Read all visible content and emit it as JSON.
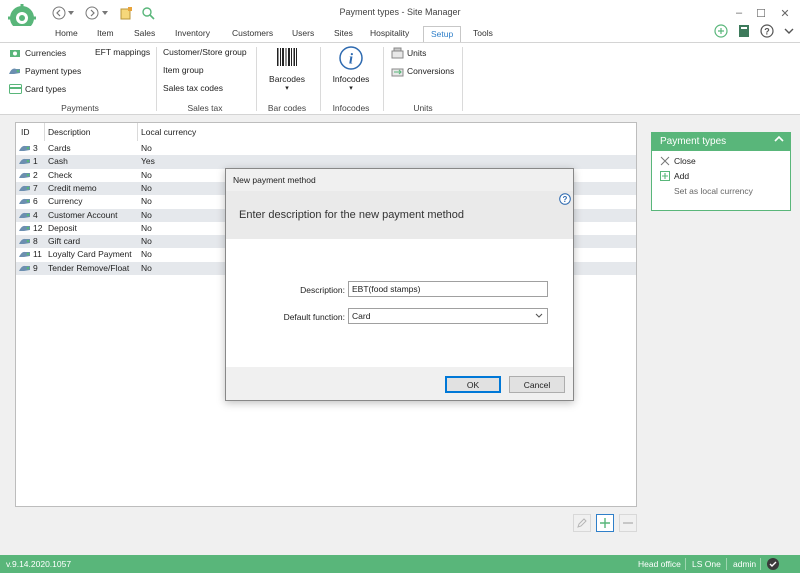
{
  "window": {
    "title": "Payment types - Site Manager",
    "minimize_glyph": "–",
    "maximize_glyph": "☐",
    "close_glyph": "✕"
  },
  "tabs": [
    {
      "label": "Home"
    },
    {
      "label": "Item"
    },
    {
      "label": "Sales"
    },
    {
      "label": "Inventory"
    },
    {
      "label": "Customers"
    },
    {
      "label": "Users"
    },
    {
      "label": "Sites"
    },
    {
      "label": "Hospitality"
    },
    {
      "label": "Setup",
      "active": true
    },
    {
      "label": "Tools"
    }
  ],
  "ribbon": {
    "payments": {
      "currencies": "Currencies",
      "payment_types": "Payment types",
      "card_types": "Card types",
      "eft_mappings": "EFT mappings",
      "group_label": "Payments"
    },
    "sales_tax": {
      "customer_store_group": "Customer/Store group",
      "item_group": "Item group",
      "sales_tax_codes": "Sales tax codes",
      "group_label": "Sales tax"
    },
    "bar_codes": {
      "barcodes": "Barcodes",
      "dropdown": "▾",
      "group_label": "Bar codes"
    },
    "infocodes": {
      "infocodes": "Infocodes",
      "dropdown": "▾",
      "group_label": "Infocodes"
    },
    "units": {
      "units": "Units",
      "conversions": "Conversions",
      "group_label": "Units"
    }
  },
  "grid": {
    "columns": [
      "ID",
      "Description",
      "Local currency"
    ],
    "rows": [
      {
        "id": "3",
        "description": "Cards",
        "local": "No"
      },
      {
        "id": "1",
        "description": "Cash",
        "local": "Yes"
      },
      {
        "id": "2",
        "description": "Check",
        "local": "No"
      },
      {
        "id": "7",
        "description": "Credit memo",
        "local": "No"
      },
      {
        "id": "6",
        "description": "Currency",
        "local": "No"
      },
      {
        "id": "4",
        "description": "Customer Account",
        "local": "No"
      },
      {
        "id": "12",
        "description": "Deposit",
        "local": "No"
      },
      {
        "id": "8",
        "description": "Gift card",
        "local": "No"
      },
      {
        "id": "11",
        "description": "Loyalty Card Payment",
        "local": "No"
      },
      {
        "id": "9",
        "description": "Tender Remove/Float",
        "local": "No"
      }
    ]
  },
  "side_panel": {
    "title": "Payment types",
    "collapse_glyph": "⌃",
    "close": "Close",
    "add": "Add",
    "set_local": "Set as local currency"
  },
  "dialog": {
    "title": "New payment method",
    "heading": "Enter description for the new payment method",
    "description_label": "Description:",
    "description_value": "EBT(food stamps)",
    "default_function_label": "Default function:",
    "default_function_value": "Card",
    "ok": "OK",
    "cancel": "Cancel"
  },
  "status": {
    "version": "v.9.14.2020.1057",
    "location": "Head office",
    "product": "LS One",
    "user": "admin"
  },
  "colors": {
    "accent_green": "#59b67a",
    "active_tab_blue": "#2f7fc9"
  }
}
